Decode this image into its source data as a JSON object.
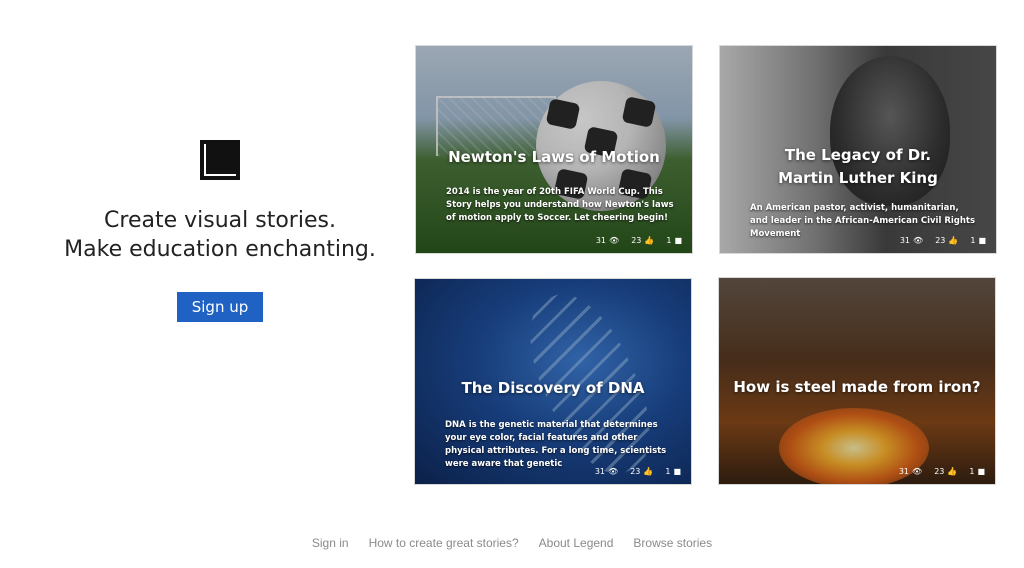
{
  "hero": {
    "line1": "Create visual stories.",
    "line2": "Make education enchanting.",
    "signup_label": "Sign up"
  },
  "cards": [
    {
      "title": "Newton's Laws of Motion",
      "description": "2014 is the year of 20th FIFA World Cup. This Story helps you understand how Newton's laws of motion apply to Soccer. Let cheering begin!",
      "views": "31",
      "likes": "23",
      "comments": "1"
    },
    {
      "title": "The Legacy of Dr. Martin Luther King",
      "description": "An American pastor, activist, humanitarian, and leader in the African-American Civil Rights Movement",
      "views": "31",
      "likes": "23",
      "comments": "1"
    },
    {
      "title": "The Discovery of DNA",
      "description": "DNA is the genetic material that determines your eye color, facial features and other physical attributes. For a long time, scientists were aware that genetic",
      "views": "31",
      "likes": "23",
      "comments": "1"
    },
    {
      "title": "How is steel made from iron?",
      "description": "",
      "views": "31",
      "likes": "23",
      "comments": "1"
    }
  ],
  "footer": {
    "links": [
      "Sign in",
      "How to create great stories?",
      "About Legend",
      "Browse stories"
    ]
  },
  "colors": {
    "accent": "#1f62c4",
    "footer_text": "#8a8a8a"
  },
  "icons": {
    "views": "eye-icon",
    "likes": "thumbs-up-icon",
    "comments": "comment-icon"
  }
}
